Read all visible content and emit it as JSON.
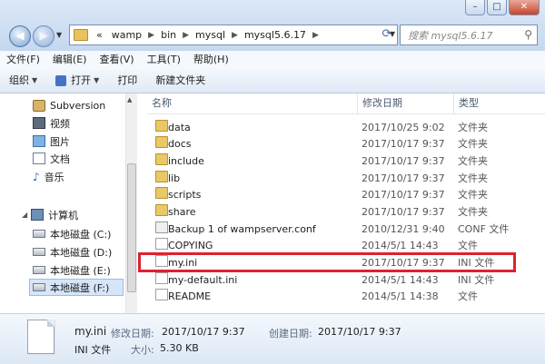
{
  "window": {
    "min_label": "–",
    "max_label": "□",
    "close_label": "✕"
  },
  "address": {
    "crumbs": [
      "«",
      "wamp",
      "bin",
      "mysql",
      "mysql5.6.17"
    ],
    "search_placeholder": "搜索 mysql5.6.17"
  },
  "menu": [
    "文件(F)",
    "编辑(E)",
    "查看(V)",
    "工具(T)",
    "帮助(H)"
  ],
  "toolbar": {
    "organize": "组织",
    "open": "打开",
    "print": "打印",
    "new_folder": "新建文件夹"
  },
  "nav": {
    "libraries": [
      {
        "label": "Subversion",
        "icon": "svn-folder-icon"
      },
      {
        "label": "视频",
        "icon": "video-library-icon"
      },
      {
        "label": "图片",
        "icon": "picture-library-icon"
      },
      {
        "label": "文档",
        "icon": "document-library-icon"
      },
      {
        "label": "音乐",
        "icon": "music-library-icon"
      }
    ],
    "computer": "计算机",
    "drives": [
      "本地磁盘 (C:)",
      "本地磁盘 (D:)",
      "本地磁盘 (E:)",
      "本地磁盘 (F:)"
    ],
    "selected_drive": "本地磁盘 (F:)"
  },
  "columns": {
    "name": "名称",
    "date": "修改日期",
    "type": "类型"
  },
  "files": [
    {
      "name": "data",
      "date": "2017/10/25 9:02",
      "type": "文件夹",
      "icon": "folder-icon"
    },
    {
      "name": "docs",
      "date": "2017/10/17 9:37",
      "type": "文件夹",
      "icon": "folder-icon"
    },
    {
      "name": "include",
      "date": "2017/10/17 9:37",
      "type": "文件夹",
      "icon": "folder-icon"
    },
    {
      "name": "lib",
      "date": "2017/10/17 9:37",
      "type": "文件夹",
      "icon": "folder-icon"
    },
    {
      "name": "scripts",
      "date": "2017/10/17 9:37",
      "type": "文件夹",
      "icon": "folder-icon"
    },
    {
      "name": "share",
      "date": "2017/10/17 9:37",
      "type": "文件夹",
      "icon": "folder-icon"
    },
    {
      "name": "Backup 1 of wampserver.conf",
      "date": "2010/12/31 9:40",
      "type": "CONF 文件",
      "icon": "config-file-icon"
    },
    {
      "name": "COPYING",
      "date": "2014/5/1 14:43",
      "type": "文件",
      "icon": "file-icon"
    },
    {
      "name": "my.ini",
      "date": "2017/10/17 9:37",
      "type": "INI 文件",
      "icon": "file-icon",
      "highlighted": true
    },
    {
      "name": "my-default.ini",
      "date": "2014/5/1 14:43",
      "type": "INI 文件",
      "icon": "file-icon"
    },
    {
      "name": "README",
      "date": "2014/5/1 14:38",
      "type": "文件",
      "icon": "file-icon"
    }
  ],
  "details": {
    "filename": "my.ini",
    "modified_label": "修改日期:",
    "modified_value": "2017/10/17 9:37",
    "created_label": "创建日期:",
    "created_value": "2017/10/17 9:37",
    "filetype": "INI 文件",
    "size_label": "大小:",
    "size_value": "5.30 KB"
  },
  "colors": {
    "highlight_border": "#e0212e",
    "selection": "#d6e6f8"
  }
}
